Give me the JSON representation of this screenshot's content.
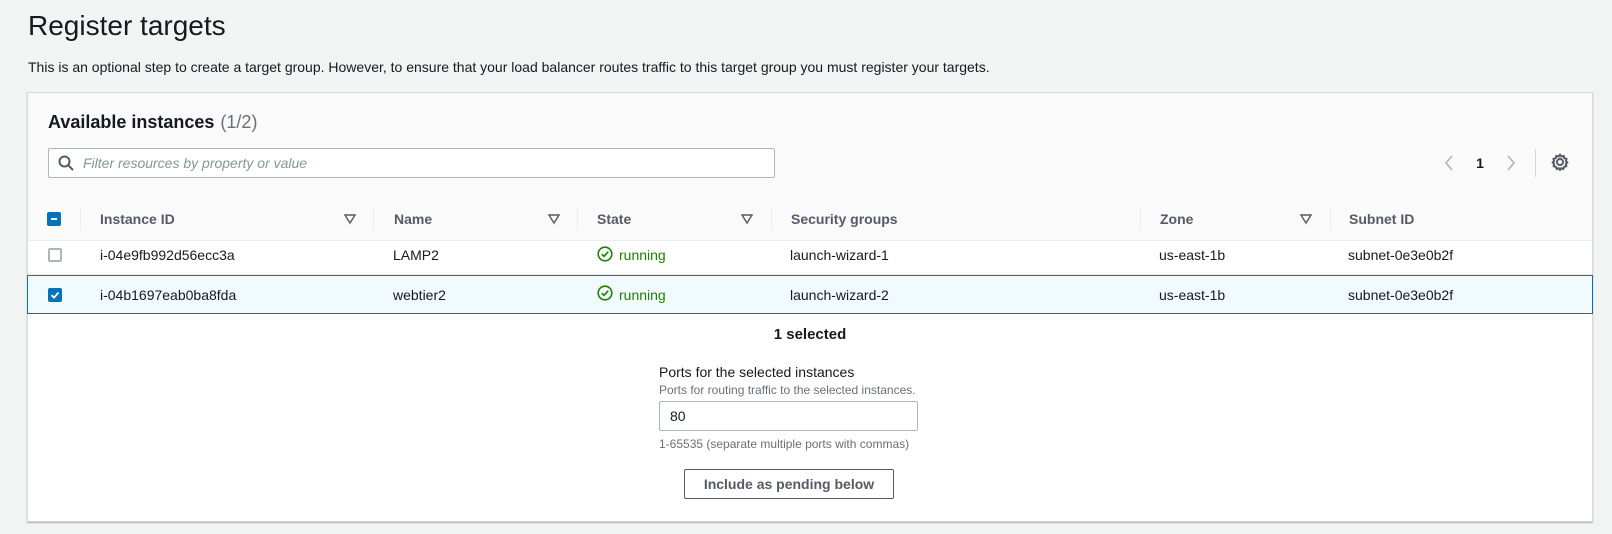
{
  "page": {
    "title": "Register targets",
    "description": "This is an optional step to create a target group. However, to ensure that your load balancer routes traffic to this target group you must register your targets."
  },
  "panel": {
    "title": "Available instances",
    "count": "(1/2)",
    "search_placeholder": "Filter resources by property or value",
    "page_number": "1"
  },
  "table": {
    "columns": [
      "Instance ID",
      "Name",
      "State",
      "Security groups",
      "Zone",
      "Subnet ID"
    ],
    "rows": [
      {
        "checked": false,
        "instance_id": "i-04e9fb992d56ecc3a",
        "name": "LAMP2",
        "state": "running",
        "security_groups": "launch-wizard-1",
        "zone": "us-east-1b",
        "subnet_id": "subnet-0e3e0b2f"
      },
      {
        "checked": true,
        "instance_id": "i-04b1697eab0ba8fda",
        "name": "webtier2",
        "state": "running",
        "security_groups": "launch-wizard-2",
        "zone": "us-east-1b",
        "subnet_id": "subnet-0e3e0b2f"
      }
    ]
  },
  "selection": {
    "count_label": "1 selected",
    "ports_label": "Ports for the selected instances",
    "ports_description": "Ports for routing traffic to the selected instances.",
    "ports_value": "80",
    "ports_hint": "1-65535 (separate multiple ports with commas)",
    "include_button": "Include as pending below"
  },
  "colors": {
    "accent": "#0073bb",
    "running": "#1d8102",
    "selected_row_bg": "#f1faff"
  },
  "icons": {
    "search": "search-icon",
    "prev": "chevron-left-icon",
    "next": "chevron-right-icon",
    "settings": "gear-icon",
    "sort": "caret-down-icon",
    "status": "check-circle-icon"
  }
}
